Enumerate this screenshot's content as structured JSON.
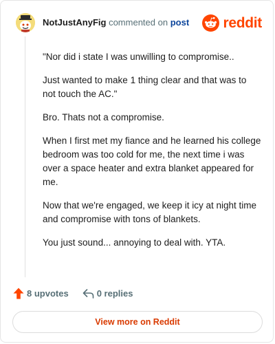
{
  "header": {
    "author": "NotJustAnyFig",
    "commented_on": "commented on",
    "post_link": "post"
  },
  "brand": {
    "wordmark": "reddit",
    "color": "#ff4500"
  },
  "comment": {
    "paragraphs": [
      "\"Nor did i state I was unwilling to compromise..",
      "Just wanted to make 1 thing clear and that was to not touch the AC.\"",
      "Bro. Thats not a compromise.",
      "When I first met my fiance and he learned his college bedroom was too cold for me, the next time i was over a space heater and extra blanket appeared for me.",
      "Now that we're engaged, we keep it icy at night time and compromise with tons of blankets.",
      "You just sound... annoying to deal with. YTA."
    ]
  },
  "actions": {
    "upvotes_label": "8 upvotes",
    "replies_label": "0 replies"
  },
  "footer": {
    "view_more_label": "View more on Reddit"
  },
  "icons": {
    "avatar": "snoo-avatar-icon",
    "brand": "reddit-snoo-icon",
    "upvote": "upvote-arrow-icon",
    "reply": "reply-arrow-icon"
  }
}
